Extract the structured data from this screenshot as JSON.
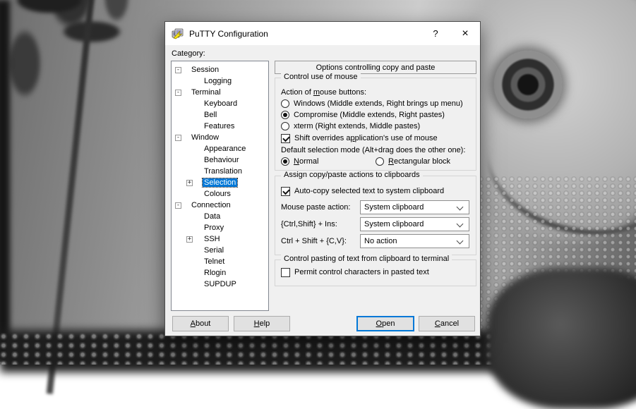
{
  "window": {
    "title": "PuTTY Configuration",
    "help_glyph": "?",
    "close_glyph": "×"
  },
  "category_label": {
    "pre": "Cate",
    "key": "g",
    "post": "ory:"
  },
  "tree": {
    "items": [
      {
        "label": "Session",
        "glyph": "-",
        "level": 0,
        "selected": false
      },
      {
        "label": "Logging",
        "glyph": "",
        "level": 1,
        "selected": false
      },
      {
        "label": "Terminal",
        "glyph": "-",
        "level": 0,
        "selected": false
      },
      {
        "label": "Keyboard",
        "glyph": "",
        "level": 1,
        "selected": false
      },
      {
        "label": "Bell",
        "glyph": "",
        "level": 1,
        "selected": false
      },
      {
        "label": "Features",
        "glyph": "",
        "level": 1,
        "selected": false
      },
      {
        "label": "Window",
        "glyph": "-",
        "level": 0,
        "selected": false
      },
      {
        "label": "Appearance",
        "glyph": "",
        "level": 1,
        "selected": false
      },
      {
        "label": "Behaviour",
        "glyph": "",
        "level": 1,
        "selected": false
      },
      {
        "label": "Translation",
        "glyph": "",
        "level": 1,
        "selected": false
      },
      {
        "label": "Selection",
        "glyph": "+",
        "level": 1,
        "selected": true
      },
      {
        "label": "Colours",
        "glyph": "",
        "level": 1,
        "selected": false
      },
      {
        "label": "Connection",
        "glyph": "-",
        "level": 0,
        "selected": false
      },
      {
        "label": "Data",
        "glyph": "",
        "level": 1,
        "selected": false
      },
      {
        "label": "Proxy",
        "glyph": "",
        "level": 1,
        "selected": false
      },
      {
        "label": "SSH",
        "glyph": "+",
        "level": 1,
        "selected": false
      },
      {
        "label": "Serial",
        "glyph": "",
        "level": 1,
        "selected": false
      },
      {
        "label": "Telnet",
        "glyph": "",
        "level": 1,
        "selected": false
      },
      {
        "label": "Rlogin",
        "glyph": "",
        "level": 1,
        "selected": false
      },
      {
        "label": "SUPDUP",
        "glyph": "",
        "level": 1,
        "selected": false
      }
    ]
  },
  "panel": {
    "banner": "Options controlling copy and paste",
    "mouse_group": {
      "legend": "Control use of mouse",
      "action_label": {
        "pre": "Action of ",
        "key": "m",
        "post": "ouse buttons:"
      },
      "radios": [
        {
          "label": "Windows (Middle extends, Right brings up menu)",
          "checked": false
        },
        {
          "label": "Compromise (Middle extends, Right pastes)",
          "checked": true
        },
        {
          "label": "xterm (Right extends, Middle pastes)",
          "checked": false
        }
      ],
      "shift_checkbox": {
        "pre": "Shift overrides a",
        "key": "p",
        "post": "plication's use of mouse",
        "checked": true
      },
      "default_mode_label": "Default selection mode (Alt+drag does the other one):",
      "mode_radios": [
        {
          "pre": "",
          "key": "N",
          "post": "ormal",
          "checked": true
        },
        {
          "pre": "",
          "key": "R",
          "post": "ectangular block",
          "checked": false
        }
      ]
    },
    "clipboard_group": {
      "legend": "Assign copy/paste actions to clipboards",
      "autocopy_checkbox": {
        "label": "Auto-copy selected text to system clipboard",
        "checked": true
      },
      "rows": [
        {
          "label": "Mouse paste action:",
          "value": "System clipboard"
        },
        {
          "label": "{Ctrl,Shift} + Ins:",
          "value": "System clipboard"
        },
        {
          "label": "Ctrl + Shift + {C,V}:",
          "value": "No action"
        }
      ]
    },
    "paste_group": {
      "legend": "Control pasting of text from clipboard to terminal",
      "permit_checkbox": {
        "label": "Permit control characters in pasted text",
        "checked": false
      }
    }
  },
  "buttons": {
    "about": {
      "pre": "",
      "key": "A",
      "post": "bout"
    },
    "help": {
      "pre": "",
      "key": "H",
      "post": "elp"
    },
    "open": {
      "pre": "",
      "key": "O",
      "post": "pen"
    },
    "cancel": {
      "pre": "",
      "key": "C",
      "post": "ancel"
    }
  },
  "colors": {
    "accent": "#0078d7",
    "selection_bg": "#0078d7",
    "selection_text": "#ffffff",
    "dialog_bg": "#f0f0f0"
  }
}
